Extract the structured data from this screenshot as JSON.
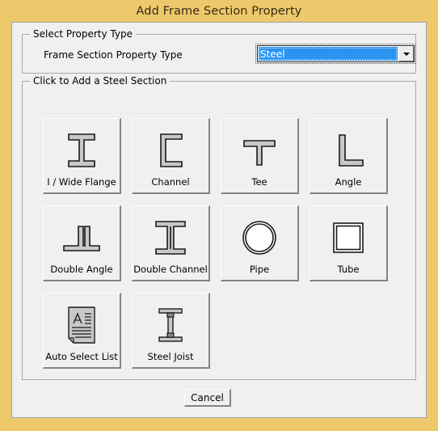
{
  "window": {
    "title": "Add Frame Section Property"
  },
  "property_type_group": {
    "legend": "Select Property Type",
    "field_label": "Frame Section Property Type",
    "combo": {
      "selected": "Steel",
      "options": [
        "Steel"
      ],
      "arrow_icon": "chevron-down-icon",
      "highlight_color": "#2a93f0"
    }
  },
  "steel_section_group": {
    "legend": "Click to Add a Steel Section",
    "buttons": [
      {
        "label": "I / Wide Flange",
        "icon": "i-wide-flange-icon"
      },
      {
        "label": "Channel",
        "icon": "channel-icon"
      },
      {
        "label": "Tee",
        "icon": "tee-icon"
      },
      {
        "label": "Angle",
        "icon": "angle-icon"
      },
      {
        "label": "Double Angle",
        "icon": "double-angle-icon"
      },
      {
        "label": "Double Channel",
        "icon": "double-channel-icon"
      },
      {
        "label": "Pipe",
        "icon": "pipe-icon"
      },
      {
        "label": "Tube",
        "icon": "tube-icon"
      },
      {
        "label": "Auto Select List",
        "icon": "auto-select-list-icon"
      },
      {
        "label": "Steel Joist",
        "icon": "steel-joist-icon"
      }
    ]
  },
  "footer": {
    "cancel_label": "Cancel"
  },
  "colors": {
    "title_bar": "#eec96b",
    "dialog_background": "#eff0ef",
    "section_fill": "#c8c8c8",
    "section_stroke": "#1a1a1a"
  }
}
